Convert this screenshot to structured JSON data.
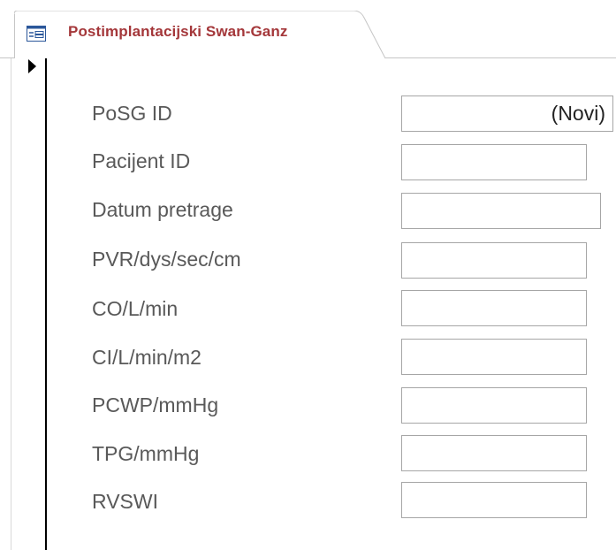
{
  "tab": {
    "title": "Postimplantacijski Swan-Ganz",
    "icon": "form-icon"
  },
  "record_selector": {
    "icon": "current-record-pointer-icon"
  },
  "fields": [
    {
      "label": "PoSG ID",
      "value": "(Novi)"
    },
    {
      "label": "Pacijent ID",
      "value": ""
    },
    {
      "label": "Datum pretrage",
      "value": ""
    },
    {
      "label": "PVR/dys/sec/cm",
      "value": ""
    },
    {
      "label": "CO/L/min",
      "value": ""
    },
    {
      "label": "CI/L/min/m2",
      "value": ""
    },
    {
      "label": "PCWP/mmHg",
      "value": ""
    },
    {
      "label": "TPG/mmHg",
      "value": ""
    },
    {
      "label": "RVSWI",
      "value": ""
    }
  ],
  "colors": {
    "tab_title": "#a4373a",
    "label": "#595959",
    "input_border": "#a6a6a6",
    "icon_accent": "#2b579a"
  }
}
